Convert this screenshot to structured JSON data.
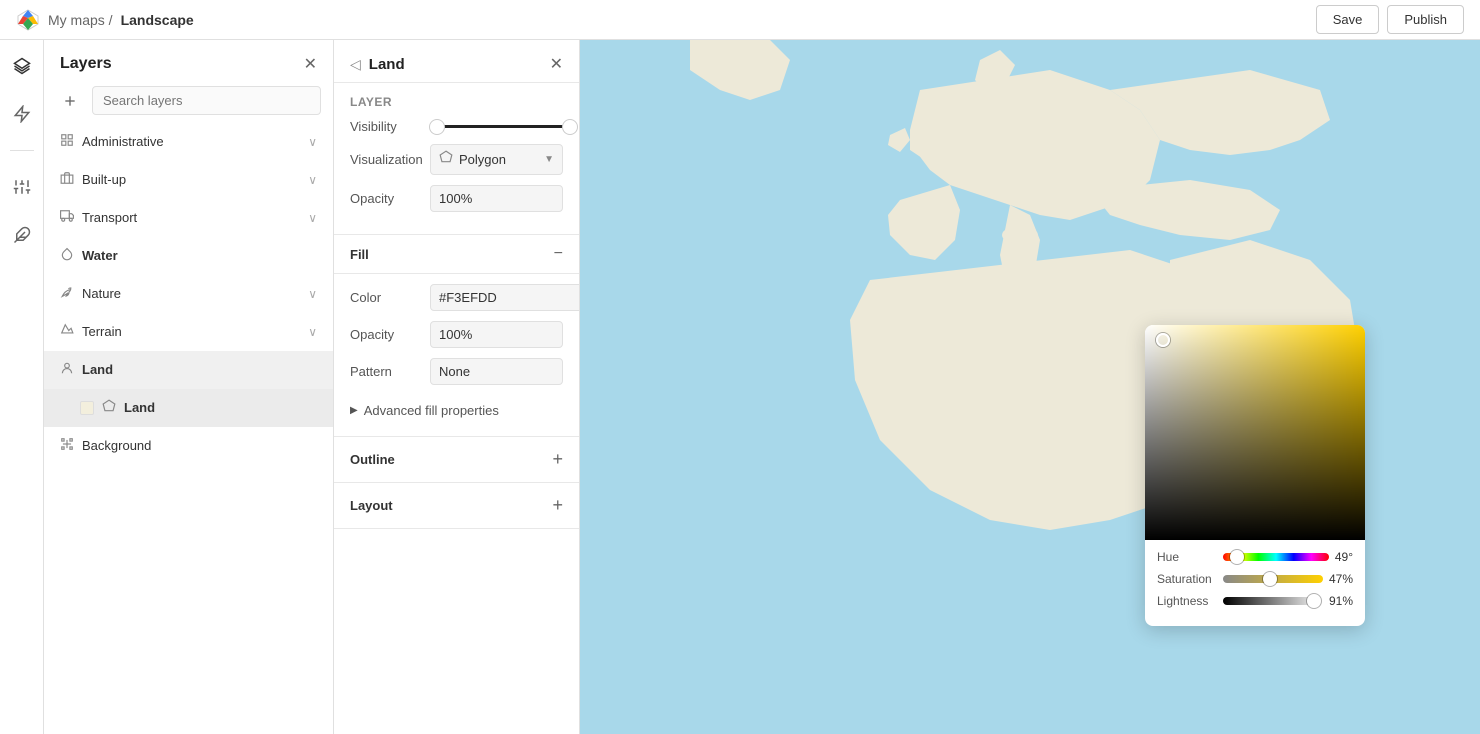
{
  "topbar": {
    "breadcrumb": "My maps /",
    "title": "Landscape",
    "save_label": "Save",
    "publish_label": "Publish"
  },
  "layers_panel": {
    "title": "Layers",
    "search_placeholder": "Search layers",
    "layers": [
      {
        "id": "administrative",
        "name": "Administrative",
        "icon": "grid",
        "has_expand": true,
        "active": false
      },
      {
        "id": "built-up",
        "name": "Built-up",
        "icon": "building",
        "has_expand": true,
        "active": false
      },
      {
        "id": "transport",
        "name": "Transport",
        "icon": "road",
        "has_expand": true,
        "active": false
      },
      {
        "id": "water",
        "name": "Water",
        "icon": "water",
        "has_expand": false,
        "active": false,
        "bold": true
      },
      {
        "id": "nature",
        "name": "Nature",
        "icon": "leaf",
        "has_expand": true,
        "active": false
      },
      {
        "id": "terrain",
        "name": "Terrain",
        "icon": "terrain",
        "has_expand": true,
        "active": false
      },
      {
        "id": "land",
        "name": "Land",
        "icon": "person",
        "has_expand": false,
        "active": true,
        "bold": true
      },
      {
        "id": "land-sub",
        "name": "Land",
        "icon": "polygon",
        "has_expand": false,
        "active": true,
        "sub": true,
        "color": "#f3efdd"
      },
      {
        "id": "background",
        "name": "Background",
        "icon": "grid2",
        "has_expand": false,
        "active": false,
        "bold": false
      }
    ]
  },
  "properties_panel": {
    "title": "Land",
    "layer_section": "Layer",
    "visibility_label": "Visibility",
    "visualization_label": "Visualization",
    "visualization_value": "Polygon",
    "opacity_label": "Opacity",
    "opacity_value": "100%",
    "fill_section": "Fill",
    "color_label": "Color",
    "color_value": "#F3EFDD",
    "fill_opacity_label": "Opacity",
    "fill_opacity_value": "100%",
    "pattern_label": "Pattern",
    "pattern_value": "None",
    "advanced_fill_label": "Advanced fill properties",
    "outline_section": "Outline",
    "layout_section": "Layout"
  },
  "color_picker": {
    "hue_label": "Hue",
    "hue_value": "49°",
    "hue_percent": 13.6,
    "saturation_label": "Saturation",
    "saturation_value": "47%",
    "saturation_percent": 47,
    "lightness_label": "Lightness",
    "lightness_value": "91%",
    "lightness_percent": 91
  }
}
